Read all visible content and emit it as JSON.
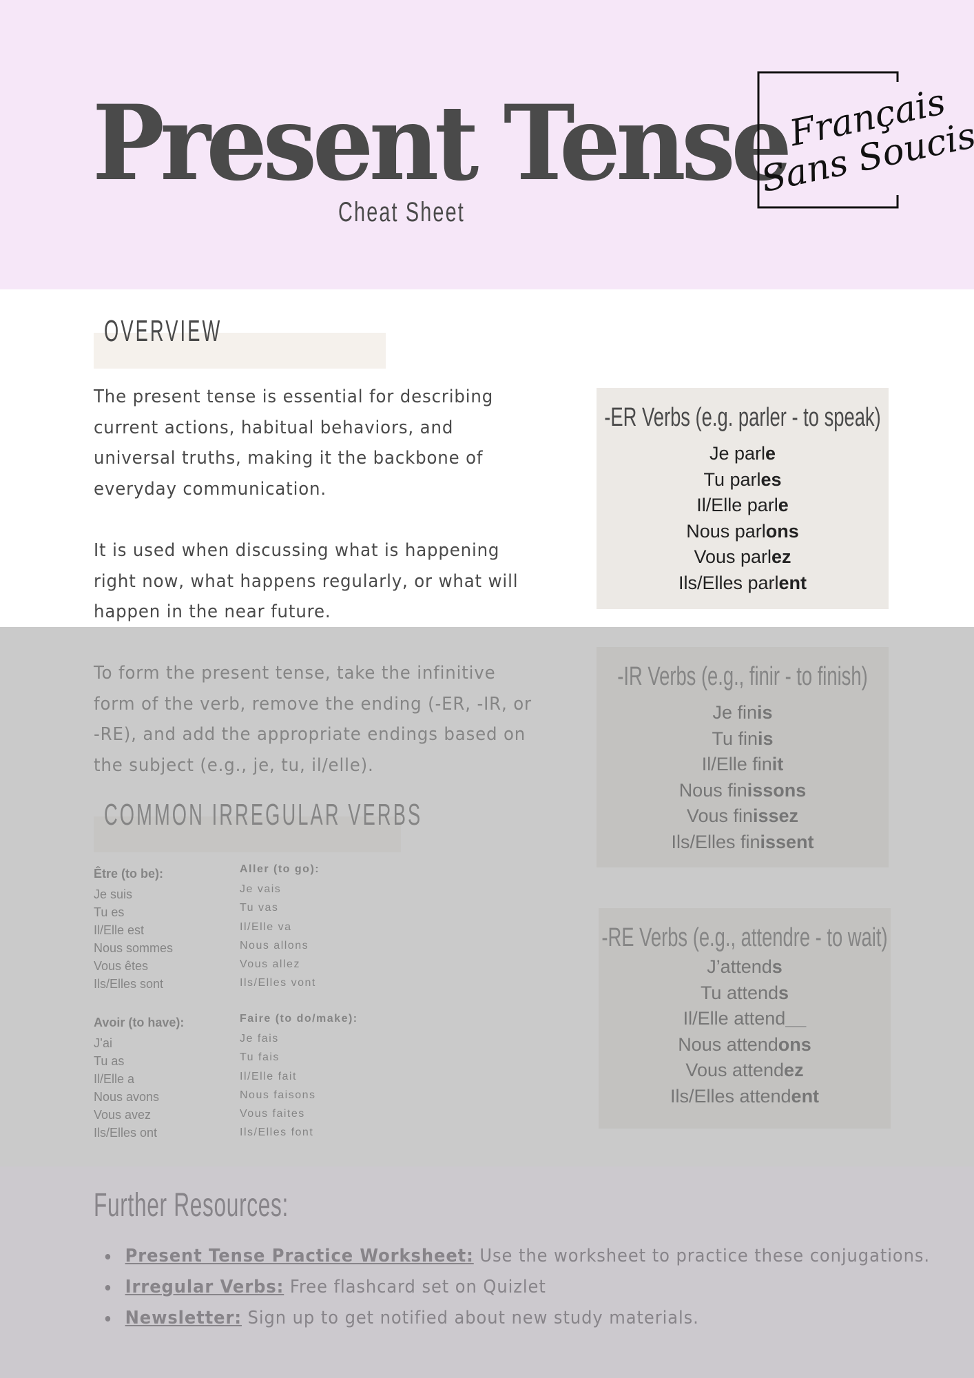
{
  "header": {
    "title": "Present Tense",
    "subtitle": "Cheat Sheet",
    "logo": {
      "line1": "Français",
      "line2": "Sans Soucis"
    },
    "background": "#f6e7f8"
  },
  "overview": {
    "heading": "OVERVIEW",
    "paragraphs": [
      "The present tense is essential for describing current actions, habitual behaviors, and universal truths, making it the backbone of everyday communication.",
      "It is used when discussing what is happening right now, what happens regularly, or what will happen in the near future.",
      "To form the present tense, take the infinitive form of the verb, remove the ending (-ER, -IR, or -RE), and add the appropriate endings based on the subject (e.g., je, tu, il/elle)."
    ]
  },
  "verb_boxes": [
    {
      "title": "-ER Verbs (e.g. parler - to speak)",
      "rows": [
        {
          "stem": "Je parl",
          "ending": "e"
        },
        {
          "stem": "Tu parl",
          "ending": "es"
        },
        {
          "stem": "Il/Elle parl",
          "ending": "e"
        },
        {
          "stem": "Nous parl",
          "ending": "ons"
        },
        {
          "stem": "Vous parl",
          "ending": "ez"
        },
        {
          "stem": "Ils/Elles parl",
          "ending": "ent"
        }
      ]
    },
    {
      "title": "-IR Verbs (e.g., finir - to finish)",
      "rows": [
        {
          "stem": "Je fin",
          "ending": "is"
        },
        {
          "stem": "Tu fin",
          "ending": "is"
        },
        {
          "stem": "Il/Elle fin",
          "ending": "it"
        },
        {
          "stem": "Nous fin",
          "ending": "issons"
        },
        {
          "stem": "Vous fin",
          "ending": "issez"
        },
        {
          "stem": "Ils/Elles fin",
          "ending": "issent"
        }
      ]
    },
    {
      "title": "-RE Verbs (e.g., attendre - to wait)",
      "rows": [
        {
          "stem": "J’attend",
          "ending": "s"
        },
        {
          "stem": "Tu attend",
          "ending": "s"
        },
        {
          "stem": "Il/Elle attend",
          "ending": "__"
        },
        {
          "stem": "Nous attend",
          "ending": "ons"
        },
        {
          "stem": "Vous attend",
          "ending": "ez"
        },
        {
          "stem": "Ils/Elles attend",
          "ending": "ent"
        }
      ]
    }
  ],
  "irregular": {
    "heading": "COMMON IRREGULAR VERBS",
    "verbs": [
      {
        "label": "Être (to be):",
        "forms": [
          "Je suis",
          "Tu es",
          "Il/Elle est",
          "Nous sommes",
          "Vous êtes",
          "Ils/Elles sont"
        ]
      },
      {
        "label": "Aller (to go):",
        "forms": [
          "Je vais",
          "Tu vas",
          "Il/Elle va",
          "Nous allons",
          "Vous allez",
          "Ils/Elles vont"
        ]
      },
      {
        "label": "Avoir (to have):",
        "forms": [
          "J’ai",
          "Tu as",
          "Il/Elle a",
          "Nous avons",
          "Vous avez",
          "Ils/Elles ont"
        ]
      },
      {
        "label": "Faire (to do/make):",
        "forms": [
          "Je fais",
          "Tu fais",
          "Il/Elle fait",
          "Nous faisons",
          "Vous faites",
          "Ils/Elles font"
        ]
      }
    ]
  },
  "resources": {
    "heading": "Further Resources:",
    "items": [
      {
        "link": "Present Tense Practice Worksheet:",
        "text": " Use the worksheet to practice these conjugations."
      },
      {
        "link": "Irregular Verbs:",
        "text": " Free flashcard set on Quizlet"
      },
      {
        "link": "Newsletter:",
        "text": " Sign up to get notified about new study materials."
      }
    ]
  }
}
